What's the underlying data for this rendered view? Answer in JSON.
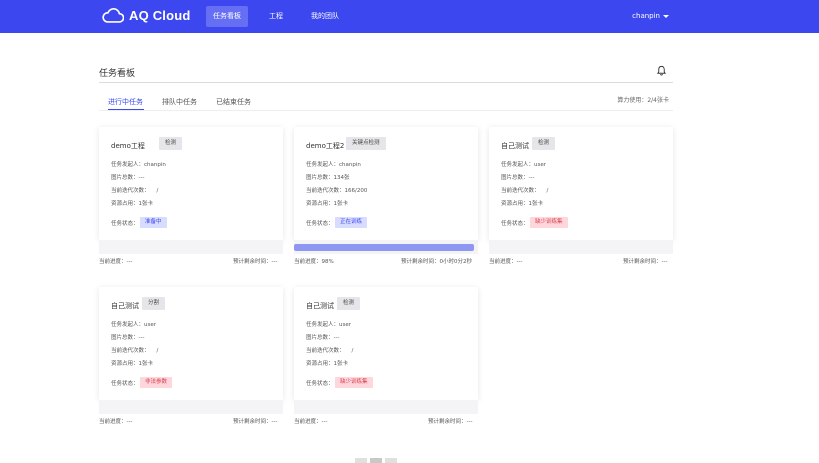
{
  "header": {
    "logo_text": "AQ Cloud",
    "nav": [
      {
        "label": "任务看板"
      },
      {
        "label": "工程"
      },
      {
        "label": "我的团队"
      }
    ],
    "user": "chanpin",
    "brand_color": "#3c47f0"
  },
  "page": {
    "title": "任务看板",
    "tabs": [
      {
        "label": "进行中任务"
      },
      {
        "label": "排队中任务"
      },
      {
        "label": "已结束任务"
      }
    ],
    "compute_usage": "算力使用：2/4张卡"
  },
  "labels": {
    "initiator": "任务发起人：",
    "image_count": "图片总数：",
    "iteration": "当前迭代次数：",
    "resources": "资源占用：",
    "status": "任务状态：",
    "progress": "当前进度：",
    "remaining": "预计剩余时间："
  },
  "tasks": [
    {
      "name": "demo工程",
      "type": "检测",
      "initiator": "chanpin",
      "images": "---",
      "iteration": "    /",
      "resources": "1张卡",
      "status": "准备中",
      "progress": "---",
      "remaining": "---"
    },
    {
      "name": "demo工程2",
      "type": "关键点检测",
      "initiator": "chanpin",
      "images": "134张",
      "iteration": "166/200",
      "resources": "1张卡",
      "status": "正在训练",
      "progress": "98%",
      "progress_fraction": 0.98,
      "remaining": "0小时0分2秒"
    },
    {
      "name": "自己测试",
      "type": "检测",
      "initiator": "user",
      "images": "---",
      "iteration": "    /",
      "resources": "1张卡",
      "status": "缺少训练集",
      "progress": "---",
      "remaining": "---"
    },
    {
      "name": "自己测试",
      "type": "分割",
      "initiator": "user",
      "images": "---",
      "iteration": "    /",
      "resources": "1张卡",
      "status": "非法参数",
      "progress": "---",
      "remaining": "---"
    },
    {
      "name": "自己测试",
      "type": "检测",
      "initiator": "user",
      "images": "---",
      "iteration": "    /",
      "resources": "1张卡",
      "status": "缺少训练集",
      "progress": "---",
      "remaining": "---"
    }
  ]
}
